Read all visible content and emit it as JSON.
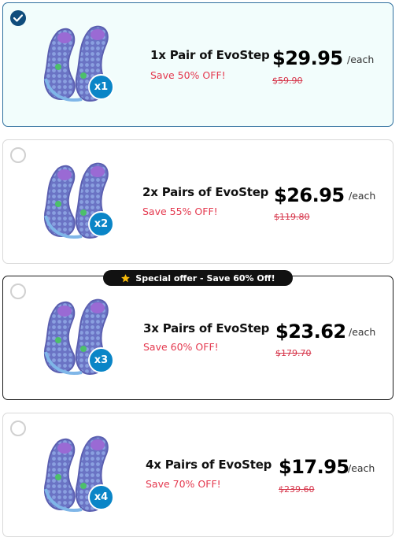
{
  "options": [
    {
      "title": "1x Pair of EvoStep",
      "save": "Save 50% OFF!",
      "price": "$29.95",
      "unit": "/each",
      "old_price": "$59.90",
      "badge": "x1",
      "selected": true
    },
    {
      "title": "2x Pairs of EvoStep",
      "save": "Save 55% OFF!",
      "price": "$26.95",
      "unit": "/each",
      "old_price": "$119.80",
      "badge": "x2",
      "selected": false
    },
    {
      "title": "3x Pairs of EvoStep",
      "save": "Save 60% OFF!",
      "price": "$23.62",
      "unit": "/each",
      "old_price": "$179.70",
      "badge": "x3",
      "selected": false
    },
    {
      "title": "4x Pairs of EvoStep",
      "save": "Save 70% OFF!",
      "price": "$17.95",
      "unit": "/each",
      "old_price": "$239.60",
      "badge": "x4",
      "selected": false
    }
  ],
  "promo": {
    "label": "Special offer - Save 60% Off!",
    "icon": "star-icon"
  },
  "colors": {
    "accent": "#0f4c7c",
    "badge": "#0a85c7",
    "save_text": "#e4384e",
    "selected_bg": "#f2fdfc"
  }
}
